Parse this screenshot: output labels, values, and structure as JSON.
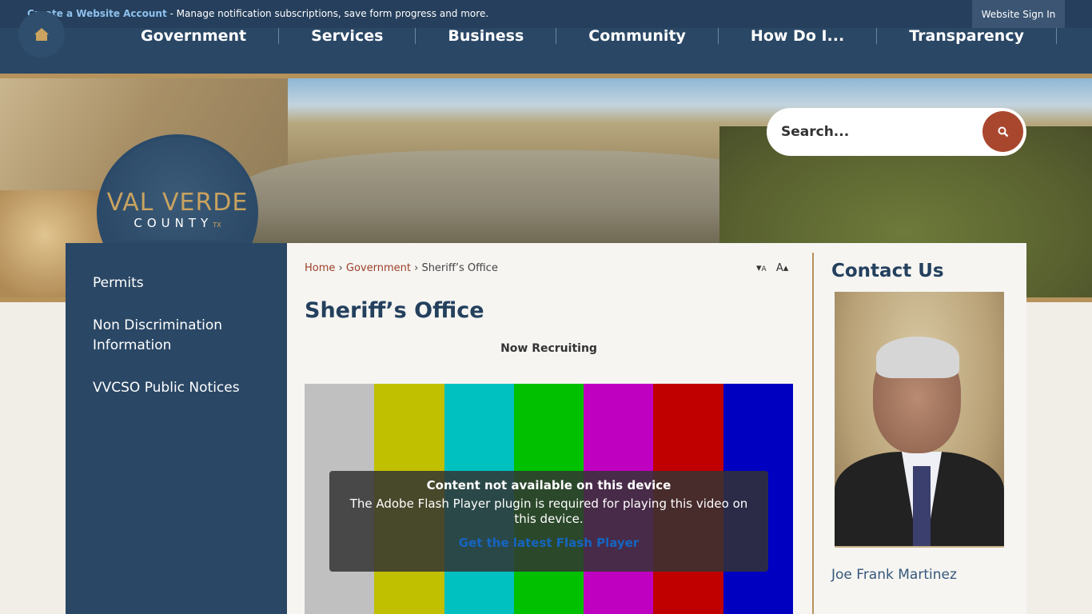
{
  "topbar": {
    "create_account_label": "Create a Website Account",
    "notice_text": " - Manage notification subscriptions, save form progress and more.",
    "signin_label": "Website Sign In"
  },
  "nav": {
    "home_icon": "home-icon",
    "items": [
      "Government",
      "Services",
      "Business",
      "Community",
      "How Do I...",
      "Transparency"
    ]
  },
  "logo": {
    "line1": "VAL VERDE",
    "line2": "COUNTY",
    "tag": "TX"
  },
  "search": {
    "placeholder": "Search...",
    "icon": "search-icon"
  },
  "sidebar": {
    "items": [
      "Permits",
      "Non Discrimination Information",
      "VVCSO Public Notices"
    ]
  },
  "breadcrumb": {
    "home": "Home",
    "sep1": "›",
    "government": "Government",
    "sep2": "›",
    "current": "Sheriff’s Office"
  },
  "textsize": {
    "decrease": "A",
    "increase": "A"
  },
  "page": {
    "title": "Sheriff’s Office",
    "subtitle": "Now Recruiting"
  },
  "video": {
    "bar_colors": [
      "#c0c0c0",
      "#c0c000",
      "#00c0c0",
      "#00c000",
      "#c000c0",
      "#c00000",
      "#0000c0"
    ],
    "overlay_heading": "Content not available on this device",
    "overlay_text": "The Adobe Flash Player plugin is required for playing this video on this device.",
    "overlay_link": "Get the latest Flash Player"
  },
  "contact": {
    "heading": "Contact Us",
    "name": "Joe Frank Martinez"
  },
  "colors": {
    "navy": "#2a4765",
    "gold": "#b5935a",
    "accent": "#a9472e"
  }
}
